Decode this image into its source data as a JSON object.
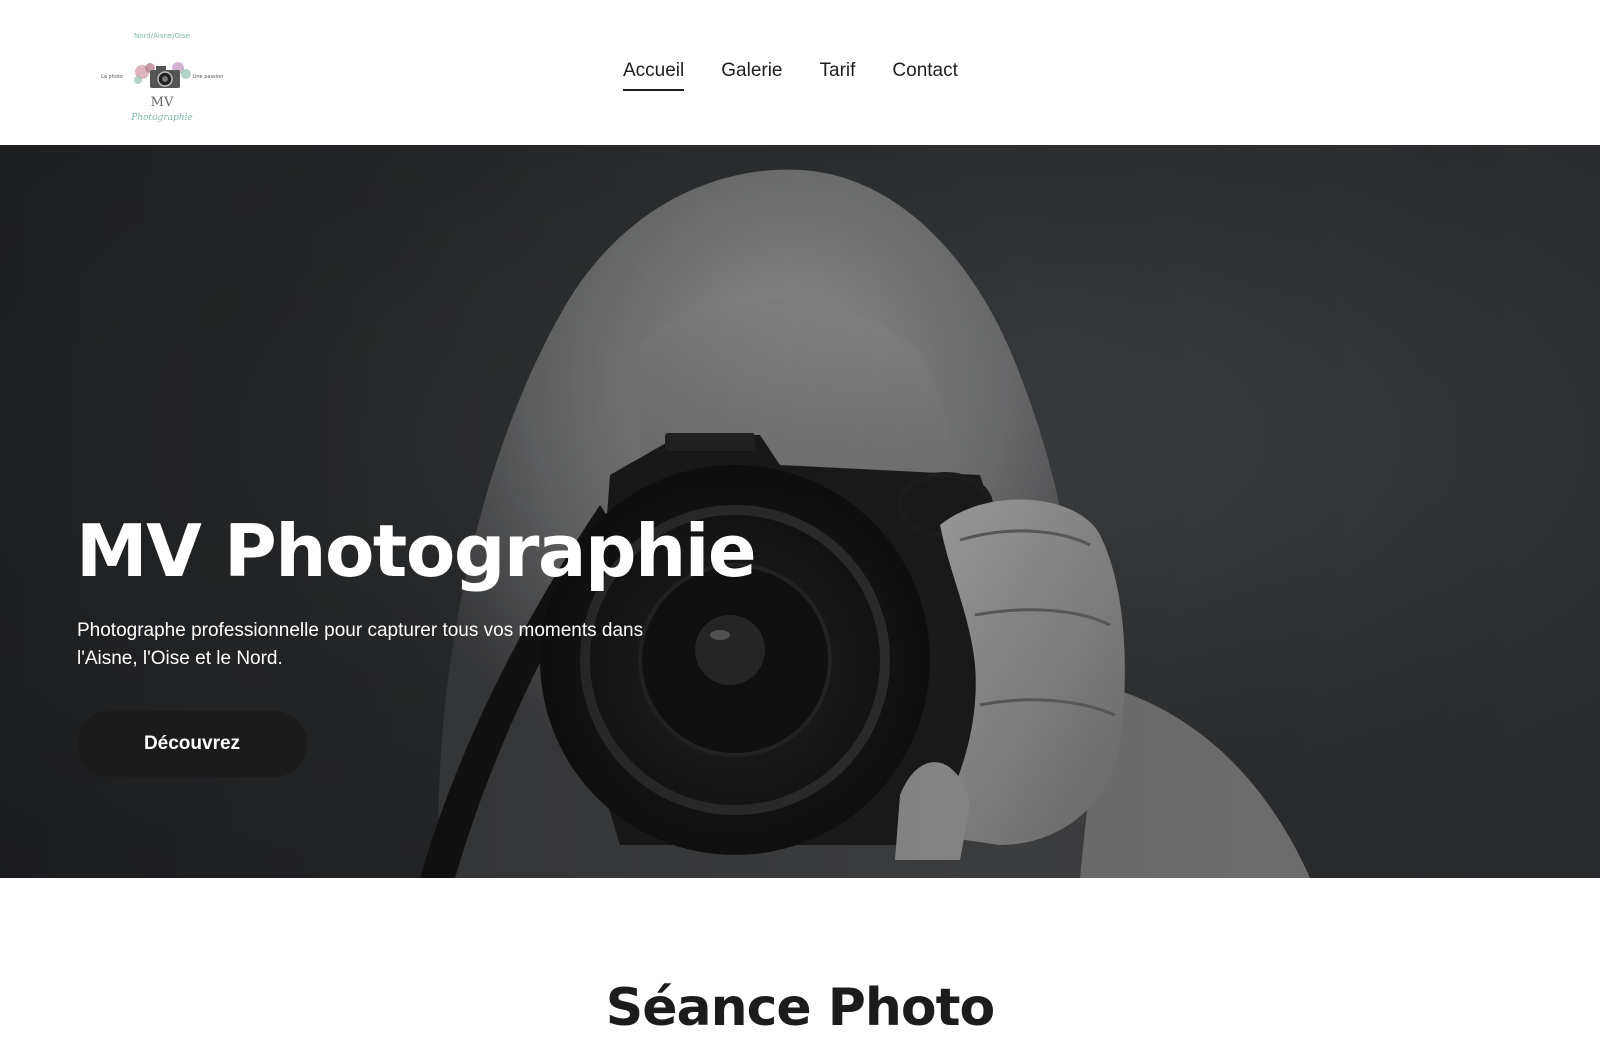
{
  "logo": {
    "top_text": "Nord/Aisne/Oise",
    "left_text": "La photo",
    "right_text": "Une passion",
    "monogram": "MV",
    "script_text": "Photographie",
    "accent_color": "#7fb9a8"
  },
  "nav": {
    "items": [
      {
        "label": "Accueil",
        "active": true
      },
      {
        "label": "Galerie",
        "active": false
      },
      {
        "label": "Tarif",
        "active": false
      },
      {
        "label": "Contact",
        "active": false
      }
    ]
  },
  "hero": {
    "title": "MV Photographie",
    "subtitle": "Photographe professionnelle pour capturer tous vos moments dans l'Aisne, l'Oise et le Nord.",
    "button_label": "Découvrez",
    "image": "grayscale-photographer-with-camera"
  },
  "section": {
    "title": "Séance Photo"
  }
}
